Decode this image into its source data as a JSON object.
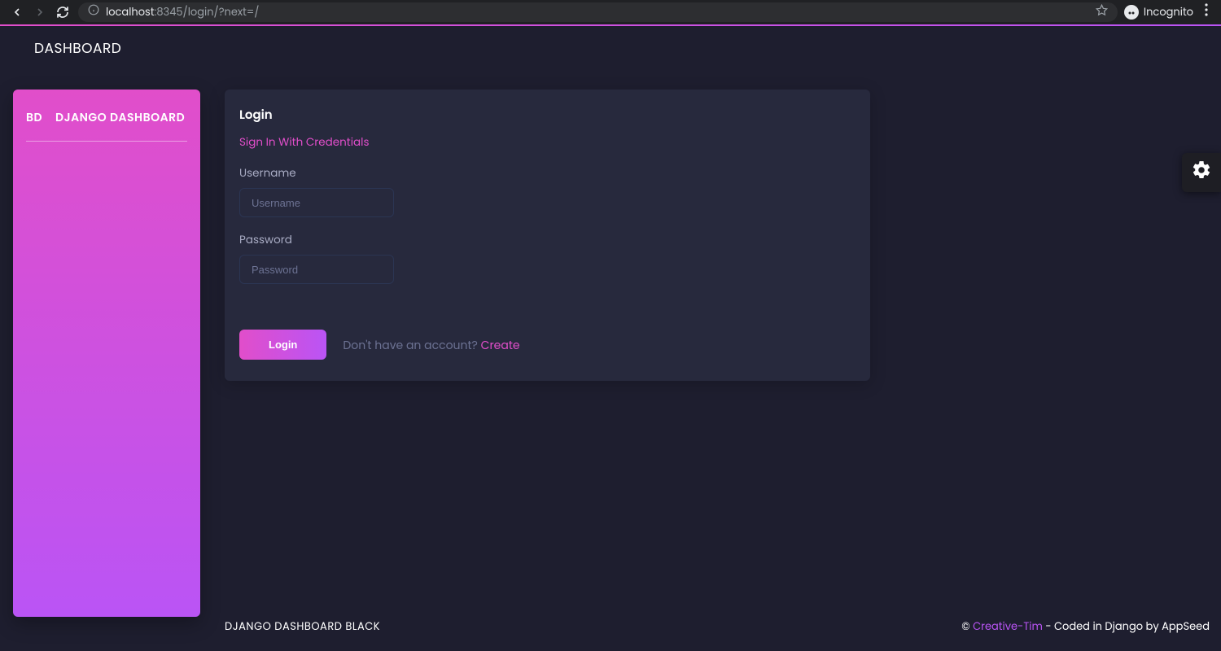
{
  "browser": {
    "url_host": "localhost",
    "url_rest": ":8345/login/?next=/",
    "incognito_label": "Incognito"
  },
  "header": {
    "title": "DASHBOARD"
  },
  "sidebar": {
    "logo_abbr": "BD",
    "brand": "DJANGO DASHBOARD"
  },
  "login": {
    "title": "Login",
    "subtitle": "Sign In With Credentials",
    "username_label": "Username",
    "username_placeholder": "Username",
    "password_label": "Password",
    "password_placeholder": "Password",
    "button_label": "Login",
    "prompt_text": "Don't have an account? ",
    "create_link": "Create"
  },
  "footer": {
    "left": "DJANGO DASHBOARD BLACK",
    "copyright": "© ",
    "link_text": "Creative-Tim",
    "tail": " - Coded in Django by AppSeed"
  }
}
